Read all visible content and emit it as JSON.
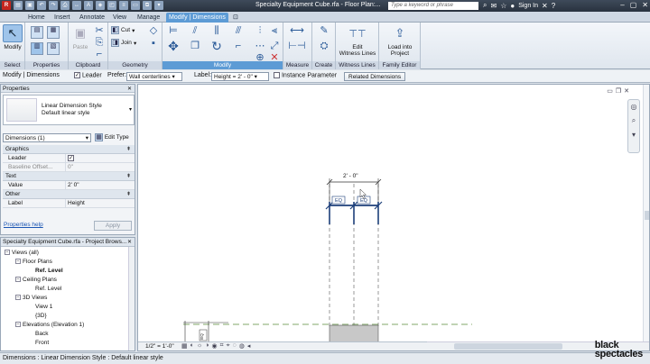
{
  "title_bar": {
    "title": "Specialty Equipment Cube.rfa - Floor Plan:...",
    "search_placeholder": "Type a keyword or phrase",
    "sign_in": "Sign In"
  },
  "tabs": [
    "Home",
    "Insert",
    "Annotate",
    "View",
    "Manage",
    "Modify | Dimensions"
  ],
  "ribbon": {
    "select": {
      "label": "Select",
      "modify": "Modify"
    },
    "properties": {
      "label": "Properties"
    },
    "clipboard": {
      "label": "Clipboard",
      "paste": "Paste"
    },
    "geometry": {
      "label": "Geometry",
      "cut": "Cut",
      "join": "Join"
    },
    "modify": {
      "label": "Modify"
    },
    "measure": {
      "label": "Measure"
    },
    "create": {
      "label": "Create"
    },
    "witness": {
      "label": "Witness Lines",
      "edit_l1": "Edit",
      "edit_l2": "Witness Lines"
    },
    "family_editor": {
      "label": "Family Editor",
      "load_l1": "Load into",
      "load_l2": "Project"
    }
  },
  "options_bar": {
    "context": "Modify | Dimensions",
    "leader": "Leader",
    "prefer_label": "Prefer:",
    "prefer_value": "Wall centerlines",
    "label_label": "Label:",
    "label_value": "Height = 2' - 0\"",
    "instance_param": "Instance Parameter",
    "related_dims": "Related Dimensions"
  },
  "properties": {
    "header": "Properties",
    "type_line1": "Linear Dimension Style",
    "type_line2": "Default linear style",
    "filter": "Dimensions (1)",
    "edit_type": "Edit Type",
    "categories": [
      {
        "name": "Graphics",
        "rows": [
          {
            "label": "Leader",
            "value": "✓"
          },
          {
            "label": "Baseline Offset...",
            "value": "0\""
          }
        ]
      },
      {
        "name": "Text",
        "rows": [
          {
            "label": "Value",
            "value": "2' 0\""
          }
        ]
      },
      {
        "name": "Other",
        "rows": [
          {
            "label": "Label",
            "value": "Height"
          }
        ]
      }
    ],
    "help_link": "Properties help",
    "apply": "Apply"
  },
  "browser": {
    "header": "Specialty Equipment Cube.rfa - Project Brows...",
    "items": [
      {
        "label": "Views (all)",
        "level": 0,
        "glyph": "−"
      },
      {
        "label": "Floor Plans",
        "level": 1,
        "glyph": "−"
      },
      {
        "label": "Ref. Level",
        "level": 2,
        "glyph": "",
        "bold": true
      },
      {
        "label": "Ceiling Plans",
        "level": 1,
        "glyph": "−"
      },
      {
        "label": "Ref. Level",
        "level": 2,
        "glyph": ""
      },
      {
        "label": "3D Views",
        "level": 1,
        "glyph": "−"
      },
      {
        "label": "View 1",
        "level": 2,
        "glyph": ""
      },
      {
        "label": "{3D}",
        "level": 2,
        "glyph": ""
      },
      {
        "label": "Elevations (Elevation 1)",
        "level": 1,
        "glyph": "−"
      },
      {
        "label": "Back",
        "level": 2,
        "glyph": ""
      },
      {
        "label": "Front",
        "level": 2,
        "glyph": ""
      }
    ]
  },
  "canvas": {
    "dimension_value": "2' - 0\"",
    "eq_label": "EQ",
    "scale": "1/2\" = 1'-0\""
  },
  "status_bar": "Dimensions : Linear Dimension Style : Default linear style",
  "watermark": {
    "line1": "black",
    "line2": "spectacles"
  },
  "colors": {
    "accent": "#5d9bd5",
    "dimension": "#1d3f7a",
    "tab_active": "#5d9bd5"
  }
}
